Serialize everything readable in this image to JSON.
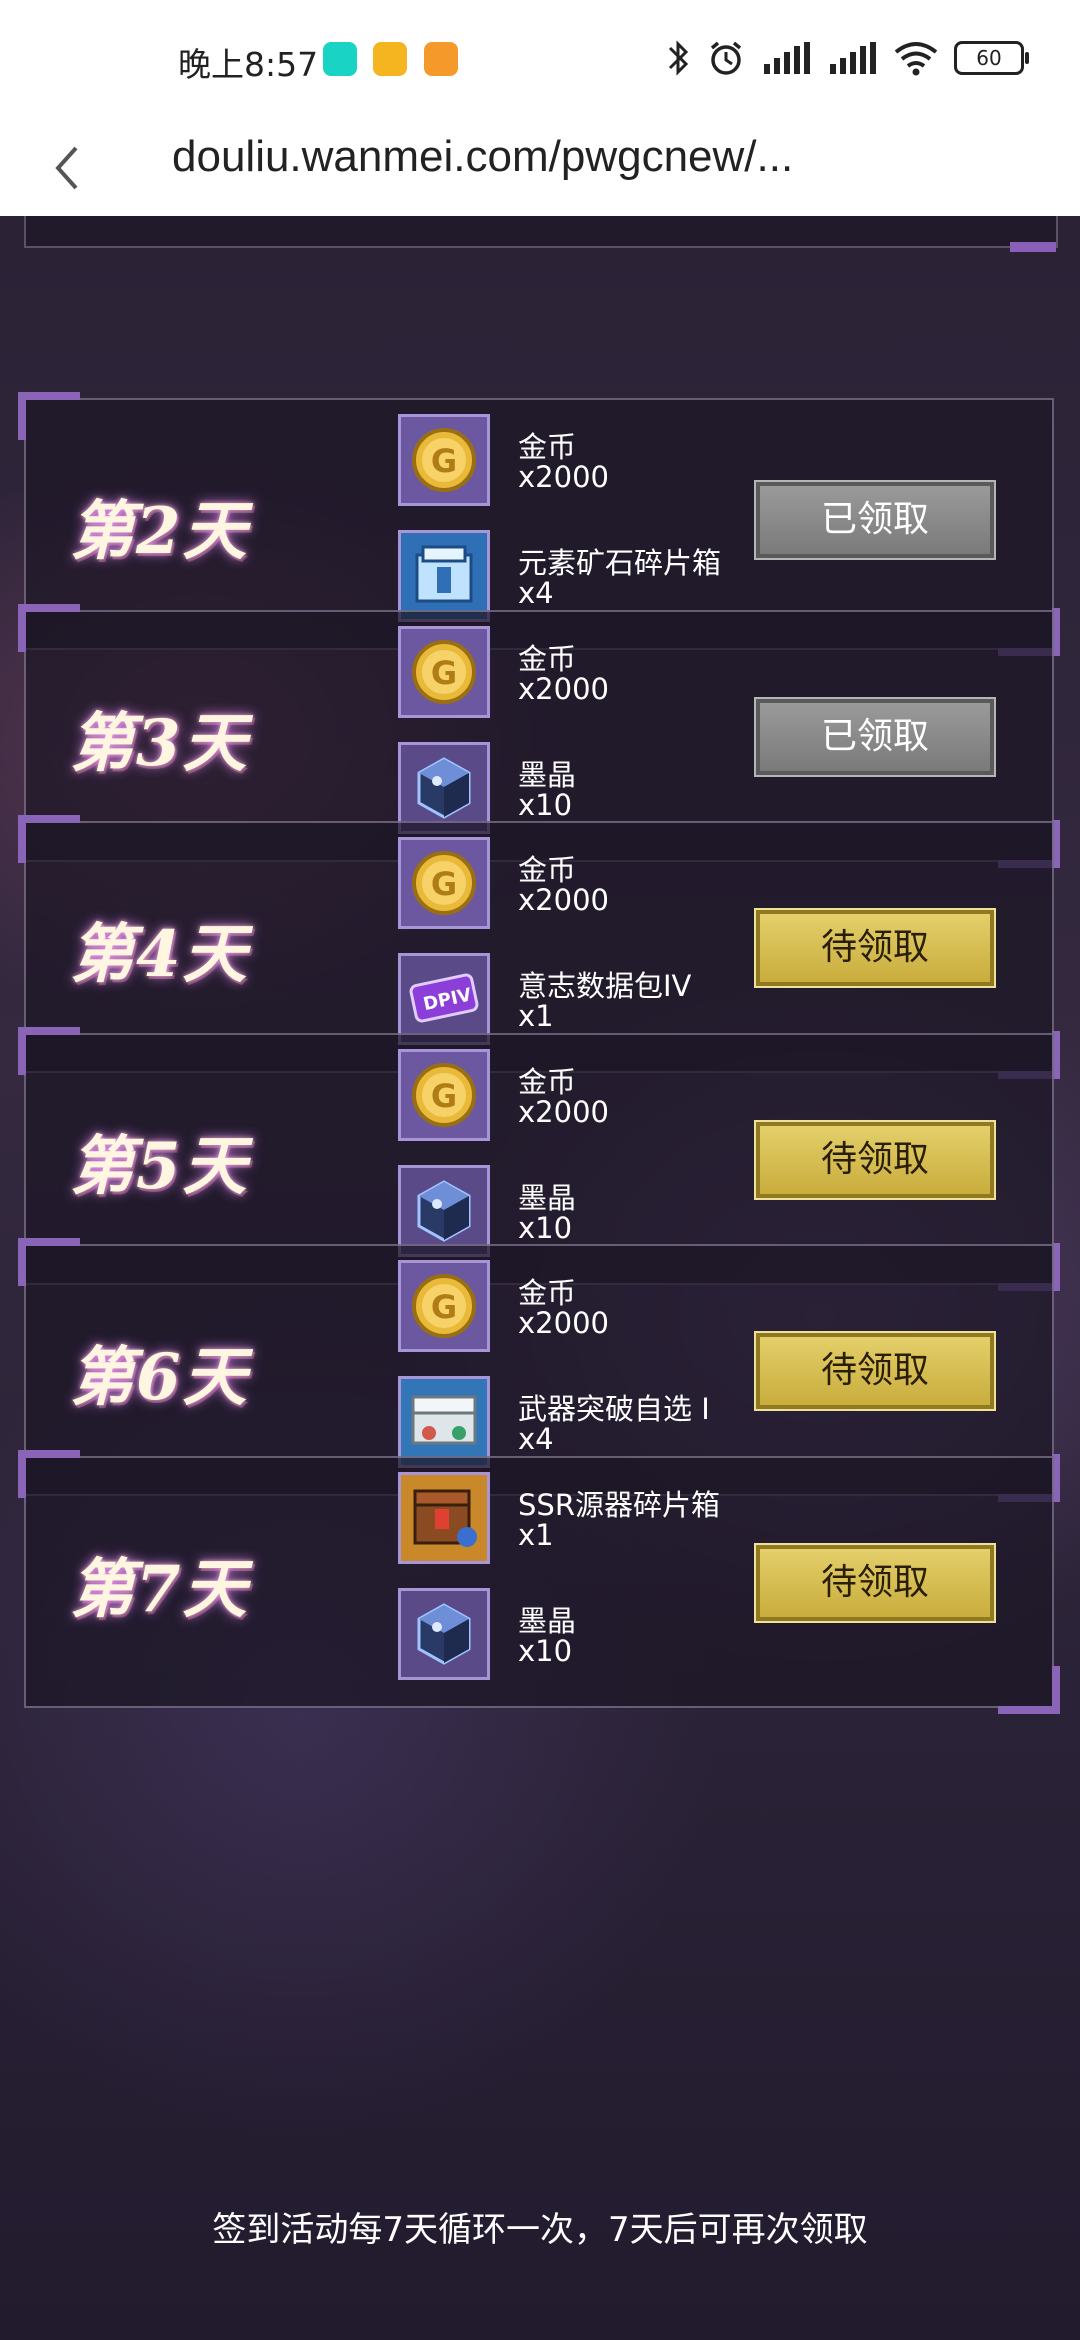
{
  "status_bar": {
    "time": "晚上8:57",
    "battery": "60",
    "notif_colors": [
      "#19d3c5",
      "#f5b521",
      "#f59a2a"
    ]
  },
  "address_bar": {
    "url": "douliu.wanmei.com/pwgcnew/..."
  },
  "days": [
    {
      "title": "第2天",
      "button": "已领取",
      "status": "claimed",
      "rewards": [
        {
          "name": "金币",
          "qty": "x2000",
          "icon": "gold-coin-icon"
        },
        {
          "name": "元素矿石碎片箱",
          "qty": "x4",
          "icon": "ore-box-icon"
        }
      ]
    },
    {
      "title": "第3天",
      "button": "已领取",
      "status": "claimed",
      "rewards": [
        {
          "name": "金币",
          "qty": "x2000",
          "icon": "gold-coin-icon"
        },
        {
          "name": "墨晶",
          "qty": "x10",
          "icon": "ink-crystal-icon"
        }
      ]
    },
    {
      "title": "第4天",
      "button": "待领取",
      "status": "pending",
      "rewards": [
        {
          "name": "金币",
          "qty": "x2000",
          "icon": "gold-coin-icon"
        },
        {
          "name": "意志数据包IV",
          "qty": "x1",
          "icon": "data-pack-icon"
        }
      ]
    },
    {
      "title": "第5天",
      "button": "待领取",
      "status": "pending",
      "rewards": [
        {
          "name": "金币",
          "qty": "x2000",
          "icon": "gold-coin-icon"
        },
        {
          "name": "墨晶",
          "qty": "x10",
          "icon": "ink-crystal-icon"
        }
      ]
    },
    {
      "title": "第6天",
      "button": "待领取",
      "status": "pending",
      "rewards": [
        {
          "name": "金币",
          "qty": "x2000",
          "icon": "gold-coin-icon"
        },
        {
          "name": "武器突破自选 I",
          "qty": "x4",
          "icon": "weapon-chest-icon"
        }
      ]
    },
    {
      "title": "第7天",
      "button": "待领取",
      "status": "pending",
      "rewards": [
        {
          "name": "SSR源器碎片箱",
          "qty": "x1",
          "icon": "ssr-box-icon"
        },
        {
          "name": "墨晶",
          "qty": "x10",
          "icon": "ink-crystal-icon"
        }
      ]
    }
  ],
  "footer": {
    "note": "签到活动每7天循环一次，7天后可再次领取"
  }
}
